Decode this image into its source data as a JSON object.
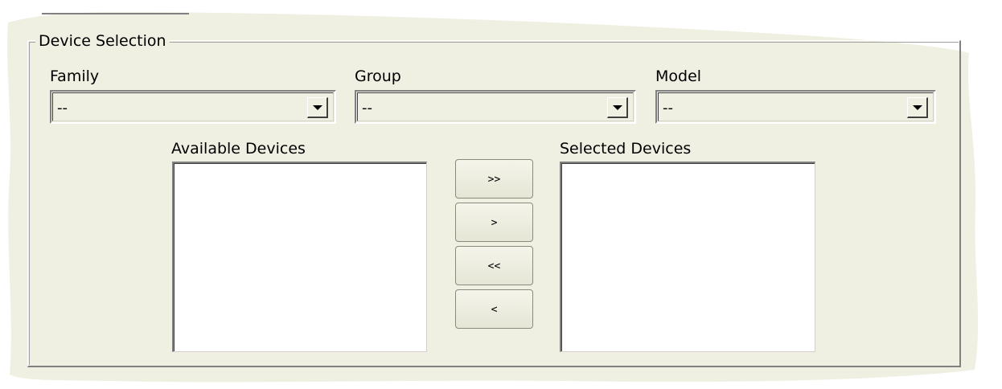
{
  "group_title": "Device Selection",
  "dropdowns": [
    {
      "label": "Family",
      "value": "--"
    },
    {
      "label": "Group",
      "value": "--"
    },
    {
      "label": "Model",
      "value": "--"
    }
  ],
  "lists": {
    "available_label": "Available Devices",
    "selected_label": "Selected Devices"
  },
  "buttons": {
    "add_all": ">>",
    "add_one": ">",
    "remove_all": "<<",
    "remove_one": "<"
  },
  "icons": {
    "dropdown": "chevron-down-icon"
  },
  "colors": {
    "panel_bg": "#efefe2",
    "list_bg": "#ffffff"
  }
}
